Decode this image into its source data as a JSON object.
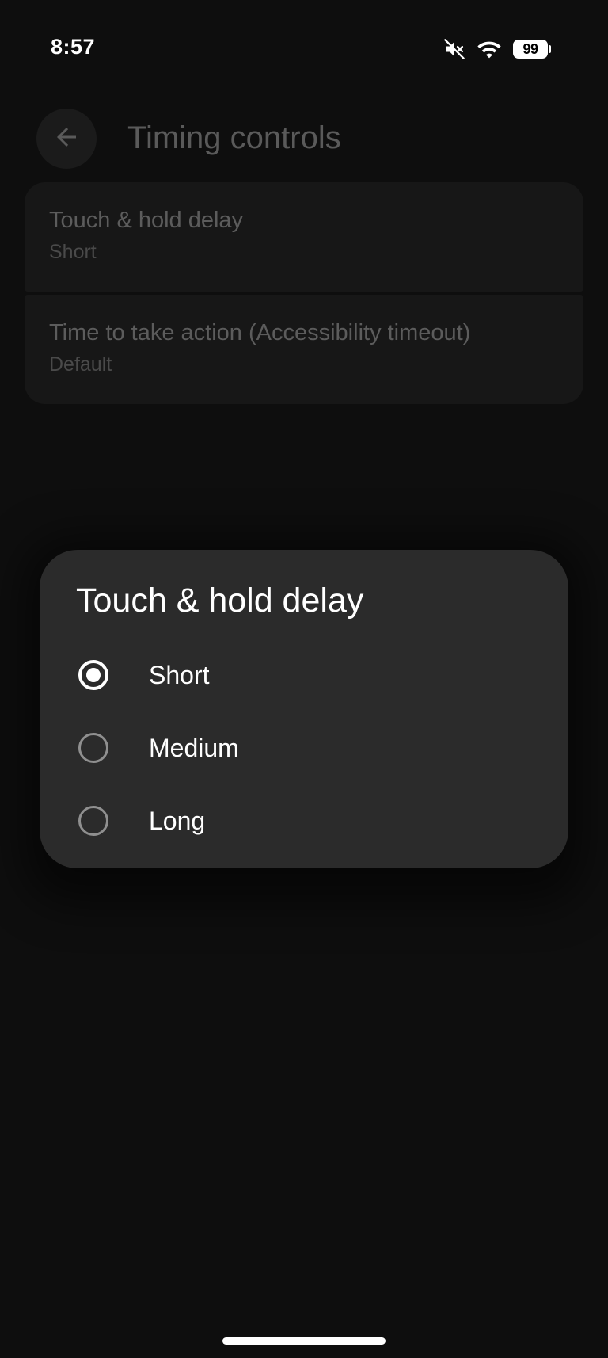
{
  "status_bar": {
    "time": "8:57",
    "battery_level": "99",
    "icons": [
      "mute-icon",
      "wifi-icon",
      "battery-icon"
    ]
  },
  "header": {
    "title": "Timing controls",
    "back_icon": "arrow-back-icon"
  },
  "settings": [
    {
      "title": "Touch & hold delay",
      "subtitle": "Short"
    },
    {
      "title": "Time to take action (Accessibility timeout)",
      "subtitle": "Default"
    }
  ],
  "dialog": {
    "title": "Touch & hold delay",
    "options": [
      {
        "label": "Short",
        "selected": true
      },
      {
        "label": "Medium",
        "selected": false
      },
      {
        "label": "Long",
        "selected": false
      }
    ]
  },
  "colors": {
    "background": "#0e0e0e",
    "dialog_background": "#2b2b2b",
    "dimmed_text": "#5a5a5a",
    "accent": "#ffffff"
  }
}
